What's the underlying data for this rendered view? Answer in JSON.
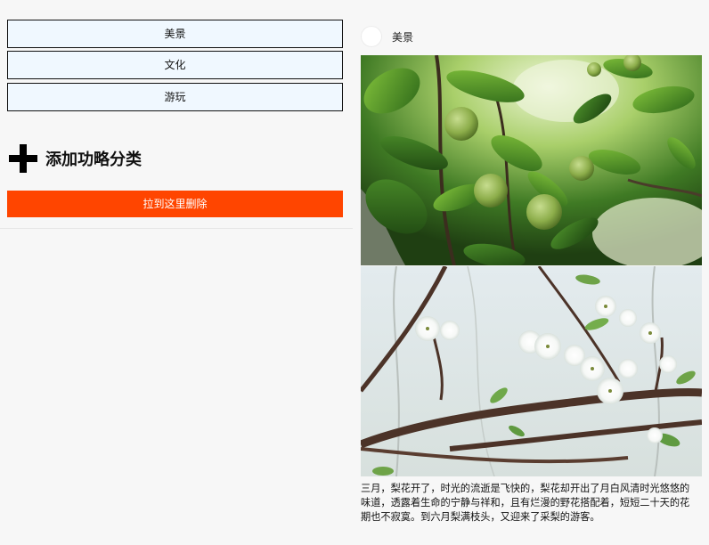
{
  "categories": [
    {
      "label": "美景"
    },
    {
      "label": "文化"
    },
    {
      "label": "游玩"
    }
  ],
  "add_category": {
    "label": "添加功略分类",
    "icon": "plus-icon"
  },
  "delete_zone": {
    "label": "拉到这里删除",
    "color": "#ff4500"
  },
  "post": {
    "author": "美景",
    "caption": "三月，梨花开了，时光的流逝是飞快的，梨花却开出了月白风清时光悠悠的味道，透露着生命的宁静与祥和，且有烂漫的野花搭配着，短短二十天的花期也不寂寞。到六月梨满枝头，又迎来了采梨的游客。"
  },
  "colors": {
    "page_bg": "#f7f7f7",
    "category_bg": "#f0f8ff",
    "delete_bg": "#ff4500"
  }
}
